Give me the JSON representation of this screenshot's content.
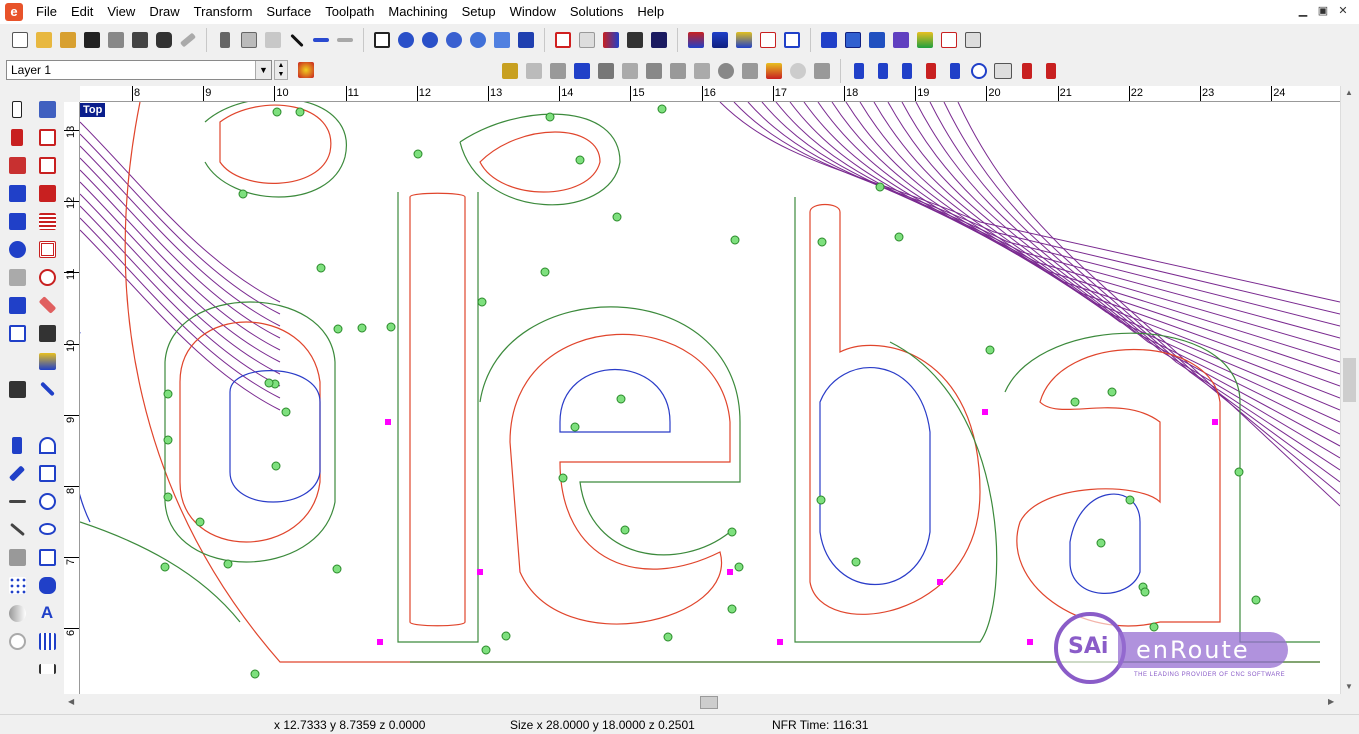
{
  "menu": [
    "File",
    "Edit",
    "View",
    "Draw",
    "Transform",
    "Surface",
    "Toolpath",
    "Machining",
    "Setup",
    "Window",
    "Solutions",
    "Help"
  ],
  "window_controls": [
    "▁",
    "▣",
    "✕"
  ],
  "layer": {
    "value": "Layer 1"
  },
  "view_label": "Top",
  "ruler_top": [
    "8",
    "9",
    "10",
    "11",
    "12",
    "13",
    "14",
    "15",
    "16",
    "17",
    "18",
    "19",
    "20",
    "21",
    "22",
    "23",
    "24"
  ],
  "ruler_left": [
    "13",
    "12",
    "11",
    "10",
    "9",
    "8",
    "7",
    "6"
  ],
  "status": {
    "cursor": "x 12.7333 y 8.7359 z 0.0000",
    "size": "Size x 28.0000 y 18.0000 z 0.2501",
    "time": "NFR Time: 116:31"
  },
  "watermark": {
    "logo": "SAi",
    "brand": "enRoute",
    "tagline": "THE LEADING PROVIDER OF CNC SOFTWARE"
  },
  "colors": {
    "offset": "#e0452c",
    "path": "#3c8a3c",
    "rough": "#7a2a90",
    "inner": "#2a3cc8",
    "marker": "#ff00ff"
  }
}
